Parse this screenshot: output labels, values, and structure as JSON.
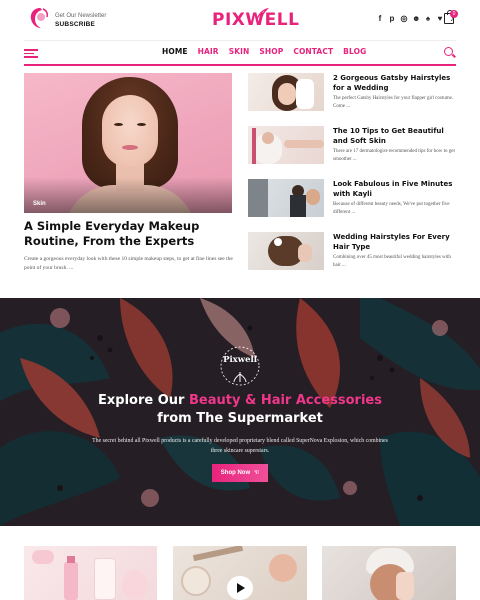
{
  "header": {
    "newsletter_small": "Get Our Newsletter",
    "newsletter_cta": "SUBSCRIBE",
    "brand": "PIXWELL",
    "cart_count": "0",
    "social_icons": [
      "facebook-icon",
      "pinterest-icon",
      "instagram-icon",
      "snapchat-icon",
      "vk-icon",
      "heart-icon",
      "tiktok-icon"
    ]
  },
  "nav": {
    "items": [
      {
        "label": "HOME",
        "active": true
      },
      {
        "label": "HAIR",
        "active": false
      },
      {
        "label": "SKIN",
        "active": false
      },
      {
        "label": "SHOP",
        "active": false
      },
      {
        "label": "CONTACT",
        "active": false
      },
      {
        "label": "BLOG",
        "active": false
      }
    ]
  },
  "featured": {
    "tag": "Skin",
    "title": "A Simple Everyday Makeup Routine, From the Experts",
    "excerpt": "Create a gorgeous everyday look with these 10 simple makeup steps, to get at fine lines see the point of your brush. ..."
  },
  "side_posts": [
    {
      "title": "2 Gorgeous Gatsby Hairstyles for a Wedding",
      "excerpt": "The perfect Gatsby Hairstyles for your flapper girl costume. Come ..."
    },
    {
      "title": "The 10 Tips to Get Beautiful and Soft Skin",
      "excerpt": "There are 17 dermatologist-recommended tips for how to get smoother ..."
    },
    {
      "title": "Look Fabulous in Five Minutes with Kayli",
      "excerpt": "Because of different beauty needs, We've put together five different ..."
    },
    {
      "title": "Wedding Hairstyles For Every Hair Type",
      "excerpt": "Combining over 45 most beautiful wedding hairstyles with hair ..."
    }
  ],
  "banner": {
    "brand": "Pixwell",
    "title_prefix": "Explore Our ",
    "title_highlight": "Beauty & Hair Accessories",
    "title_line2": "from The Supermarket",
    "description": "The secret behind all Pixwell products is a carefully developed proprietary blend called SuperNova Explosion, which combines three skincare superstars.",
    "button": "Shop Now"
  },
  "colors": {
    "accent": "#e8237c",
    "banner_bg": "#241e26"
  }
}
